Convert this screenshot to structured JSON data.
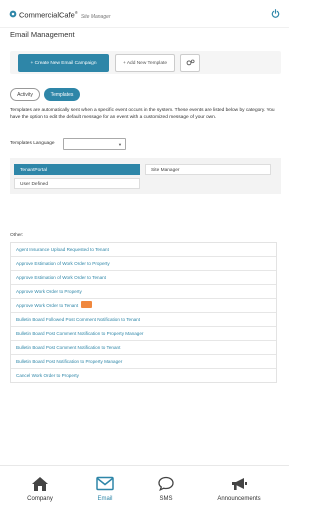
{
  "header": {
    "brand": "CommercialCafe",
    "brand_mark": "®",
    "brand_sub": "Site Manager"
  },
  "page_title": "Email Management",
  "actions": {
    "create_label": "+ Create New Email Campaign",
    "add_label": "+ Add New Template"
  },
  "view_tabs": {
    "activity": "Activity",
    "templates": "Templates"
  },
  "description": "Templates are automatically sent when a specific event occurs in the system. These events are listed below by category. You have the option to edit the default message for an event with a customized message of your own.",
  "language": {
    "label": "Templates Language",
    "value": ""
  },
  "categories": [
    "TenantPortal",
    "Site Manager",
    "User Defined"
  ],
  "selected_category": "TenantPortal",
  "other_label": "Other:",
  "templates": [
    "Agent Insurance Upload Requested to Tenant",
    "Approve Estimation of Work Order to Property",
    "Approve Estimation of Work Order to Tenant",
    "Approve Work Order to Property",
    "Approve Work Order to Tenant",
    "Bulletin Board Followed Post Comment Notification to Tenant",
    "Bulletin Board Post Comment Notification to Property Manager",
    "Bulletin Board Post Comment Notification to Tenant",
    "Bulletin Board Post Notification to Property Manager",
    "Cancel Work Order to Property"
  ],
  "bottom_nav": {
    "company": "Company",
    "email": "Email",
    "sms": "SMS",
    "announcements": "Announcements"
  },
  "colors": {
    "accent": "#2e86a8",
    "badge": "#f0883e"
  }
}
